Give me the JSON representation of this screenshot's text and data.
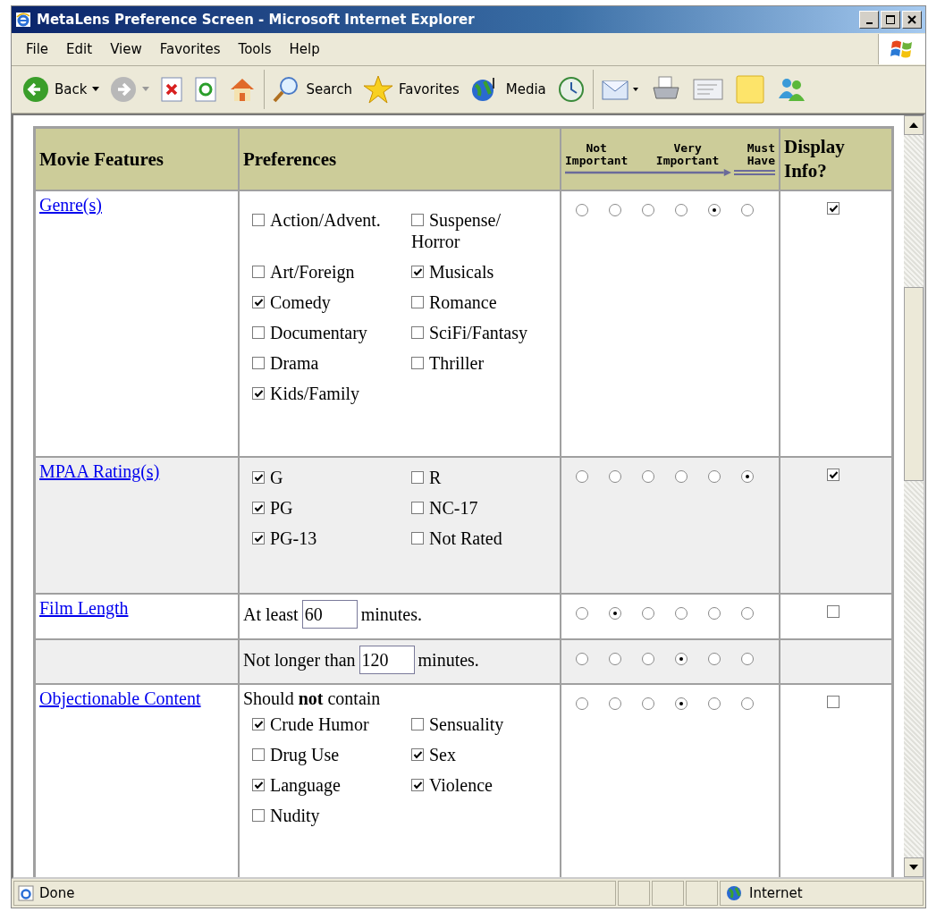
{
  "window": {
    "title": "MetaLens Preference Screen - Microsoft Internet Explorer"
  },
  "menu": [
    "File",
    "Edit",
    "View",
    "Favorites",
    "Tools",
    "Help"
  ],
  "toolbar": [
    {
      "kind": "back",
      "label": "Back"
    },
    {
      "kind": "forward"
    },
    {
      "kind": "stop"
    },
    {
      "kind": "refresh"
    },
    {
      "kind": "home"
    },
    {
      "kind": "search",
      "label": "Search"
    },
    {
      "kind": "favorites",
      "label": "Favorites"
    },
    {
      "kind": "media",
      "label": "Media"
    },
    {
      "kind": "history"
    },
    {
      "kind": "mail"
    },
    {
      "kind": "print"
    },
    {
      "kind": "edit"
    },
    {
      "kind": "note"
    },
    {
      "kind": "messenger"
    }
  ],
  "table": {
    "columns": [
      "Movie Features",
      "Preferences",
      {
        "left": "Not Important",
        "middle": "Very Important",
        "right": "Must Have"
      },
      "Display Info?"
    ],
    "rows": [
      {
        "feature": "Genre(s)",
        "shaded": false,
        "preferences": {
          "kind": "checkboxes",
          "options": [
            {
              "label": "Action/Advent.",
              "checked": false
            },
            {
              "label": "Suspense/ Horror",
              "checked": false
            },
            {
              "label": "Art/Foreign",
              "checked": false
            },
            {
              "label": "Musicals",
              "checked": true
            },
            {
              "label": "Comedy",
              "checked": true
            },
            {
              "label": "Romance",
              "checked": false
            },
            {
              "label": "Documentary",
              "checked": false
            },
            {
              "label": "SciFi/Fantasy",
              "checked": false
            },
            {
              "label": "Drama",
              "checked": false
            },
            {
              "label": "Thriller",
              "checked": false
            },
            {
              "label": "Kids/Family",
              "checked": true
            }
          ]
        },
        "importance": [
          {
            "selected": false
          },
          {
            "selected": false
          },
          {
            "selected": false
          },
          {
            "selected": false
          },
          {
            "selected": true
          },
          {
            "selected": false
          }
        ],
        "display": {
          "checked": true
        }
      },
      {
        "feature": "MPAA Rating(s)",
        "shaded": true,
        "preferences": {
          "kind": "checkboxes",
          "options": [
            {
              "label": "G",
              "checked": true
            },
            {
              "label": "R",
              "checked": false
            },
            {
              "label": "PG",
              "checked": true
            },
            {
              "label": "NC-17",
              "checked": false
            },
            {
              "label": "PG-13",
              "checked": true
            },
            {
              "label": "Not Rated",
              "checked": false
            }
          ]
        },
        "importance": [
          {
            "selected": false
          },
          {
            "selected": false
          },
          {
            "selected": false
          },
          {
            "selected": false
          },
          {
            "selected": false
          },
          {
            "selected": true
          }
        ],
        "display": {
          "checked": true
        }
      },
      {
        "feature": "Film Length",
        "shaded": false,
        "preferences": {
          "kind": "number",
          "before": "At least",
          "value": "60",
          "after": "minutes."
        },
        "importance": [
          {
            "selected": false
          },
          {
            "selected": true
          },
          {
            "selected": false
          },
          {
            "selected": false
          },
          {
            "selected": false
          },
          {
            "selected": false
          }
        ],
        "display": {
          "checked": false
        }
      },
      {
        "shaded": true,
        "preferences": {
          "kind": "number",
          "before": "Not longer than",
          "value": "120",
          "after": "minutes."
        },
        "importance": [
          {
            "selected": false
          },
          {
            "selected": false
          },
          {
            "selected": false
          },
          {
            "selected": true
          },
          {
            "selected": false
          },
          {
            "selected": false
          }
        ]
      },
      {
        "feature": "Objectionable Content",
        "shaded": false,
        "preferences": {
          "kind": "checkboxes",
          "intro": "Should **not** contain",
          "options": [
            {
              "label": "Crude Humor",
              "checked": true
            },
            {
              "label": "Sensuality",
              "checked": false
            },
            {
              "label": "Drug Use",
              "checked": false
            },
            {
              "label": "Sex",
              "checked": true
            },
            {
              "label": "Language",
              "checked": true
            },
            {
              "label": "Violence",
              "checked": true
            },
            {
              "label": "Nudity",
              "checked": false
            }
          ]
        },
        "importance": [
          {
            "selected": false
          },
          {
            "selected": false
          },
          {
            "selected": false
          },
          {
            "selected": true
          },
          {
            "selected": false
          },
          {
            "selected": false
          }
        ],
        "display": {
          "checked": false
        }
      }
    ]
  },
  "status_bar": {
    "text": "Done",
    "zone": "Internet"
  }
}
